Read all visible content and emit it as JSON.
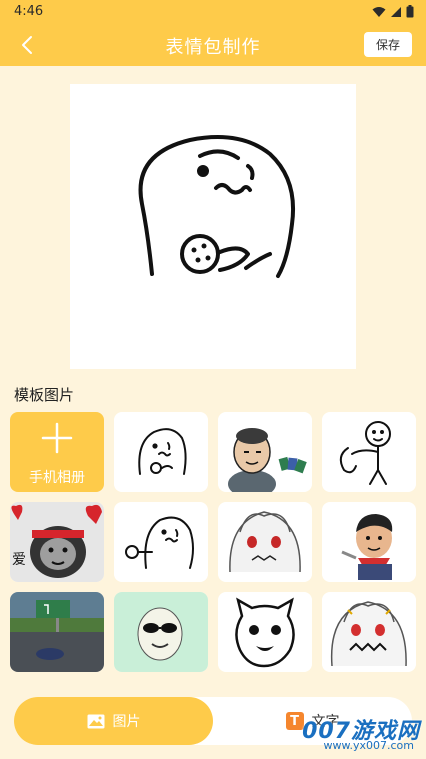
{
  "status": {
    "time": "4:46",
    "icons": [
      "wifi-icon",
      "signal-icon",
      "battery-icon"
    ]
  },
  "header": {
    "title": "表情包制作",
    "save_label": "保存",
    "back_icon": "back-chevron-icon"
  },
  "section": {
    "title": "模板图片"
  },
  "grid": {
    "add_label": "手机相册",
    "add_icon": "plus-icon",
    "templates": [
      "template-doodle-cookie",
      "template-bald-cards",
      "template-doodle-hug",
      "template-panda-love",
      "template-doodle-cookie-hand",
      "template-anime-girl",
      "template-boy-red-scarf",
      "template-road-photo",
      "template-sunglasses-face",
      "template-pig-face",
      "template-anime-girl-angry"
    ],
    "tile_texts": {
      "love": "爱"
    }
  },
  "bottom_tabs": {
    "image_label": "图片",
    "image_icon": "image-icon",
    "text_label": "文字",
    "text_icon": "text-T-icon",
    "text_icon_glyph": "T"
  },
  "watermark": {
    "main": "007游戏网",
    "sub": "www.yx007.com"
  },
  "colors": {
    "accent": "#FECB4A",
    "background": "#FEF4DC",
    "text_icon": "#F5862E"
  }
}
